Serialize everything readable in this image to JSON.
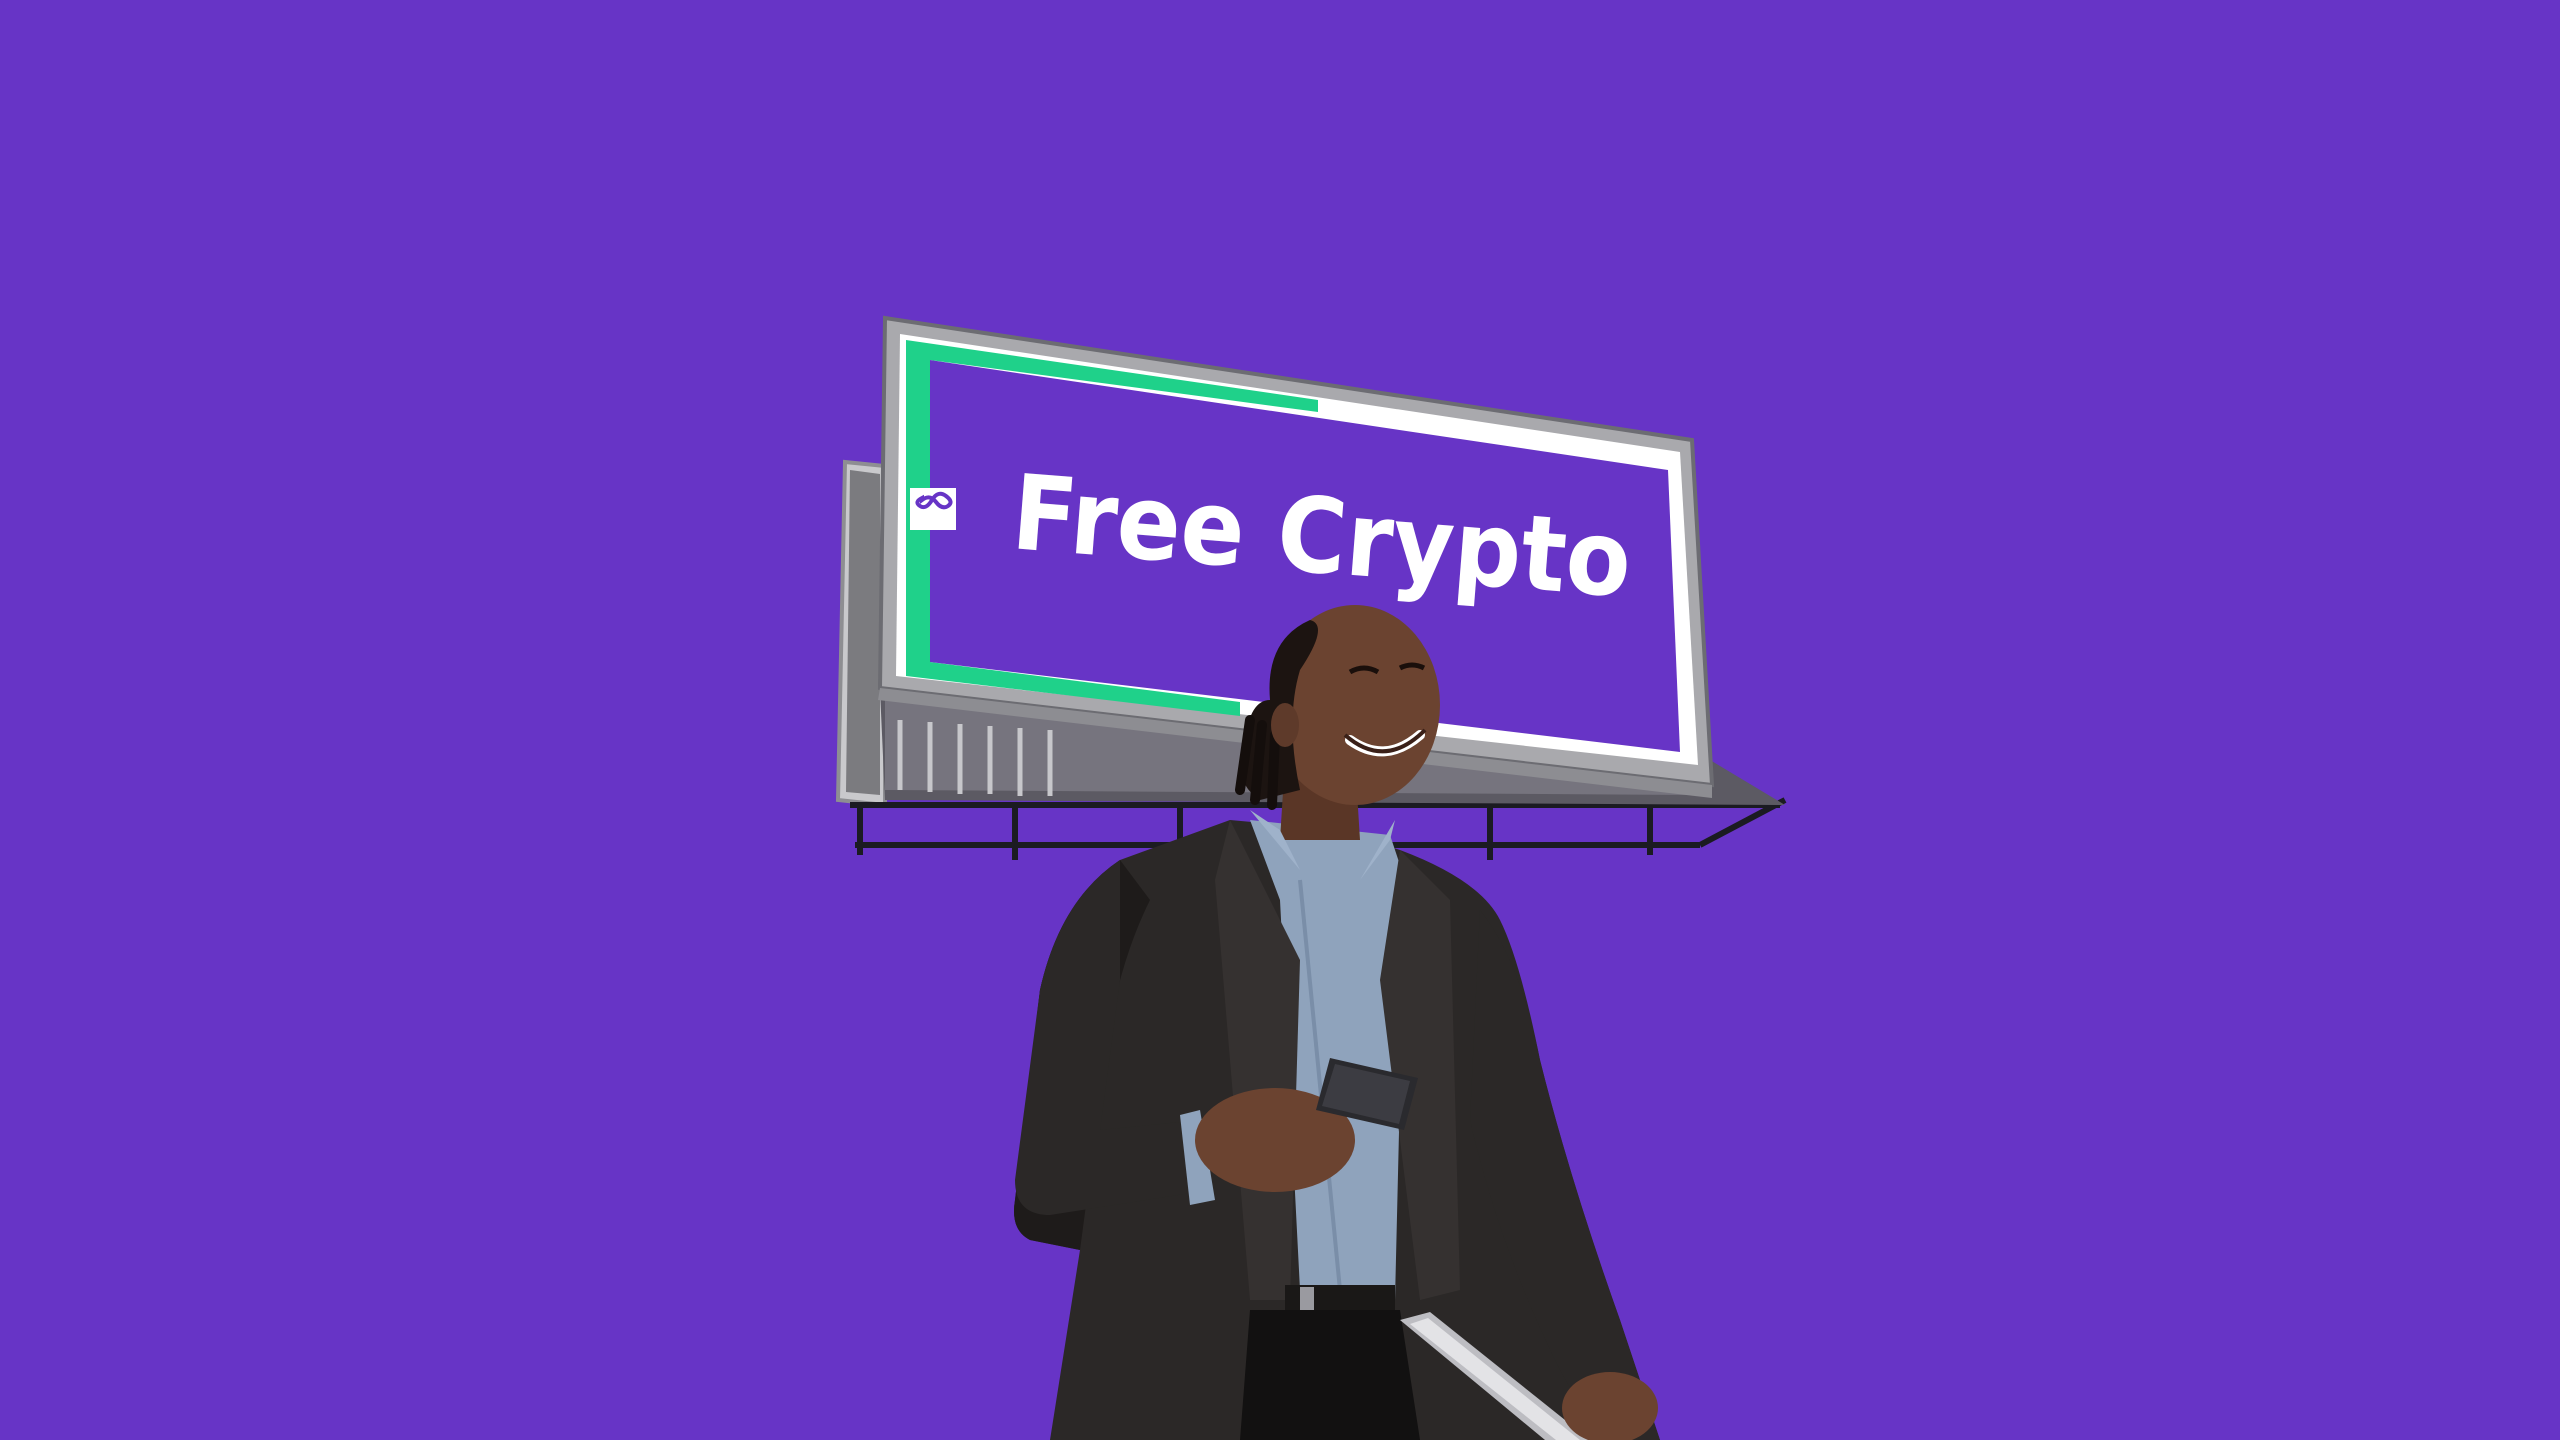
{
  "billboard": {
    "headline": "Free Crypto",
    "logo_icon": "infinity-link-icon"
  },
  "colors": {
    "background": "#6734c6",
    "billboard_panel": "#6734c6",
    "accent_green": "#1fd18a",
    "frame_white": "#ffffff",
    "frame_steel": "#a9a9ad",
    "suit": "#2b2827",
    "shirt": "#8fa3bc",
    "skin": "#6b4330"
  },
  "subject": {
    "icon": "man-with-phone-illustration"
  }
}
